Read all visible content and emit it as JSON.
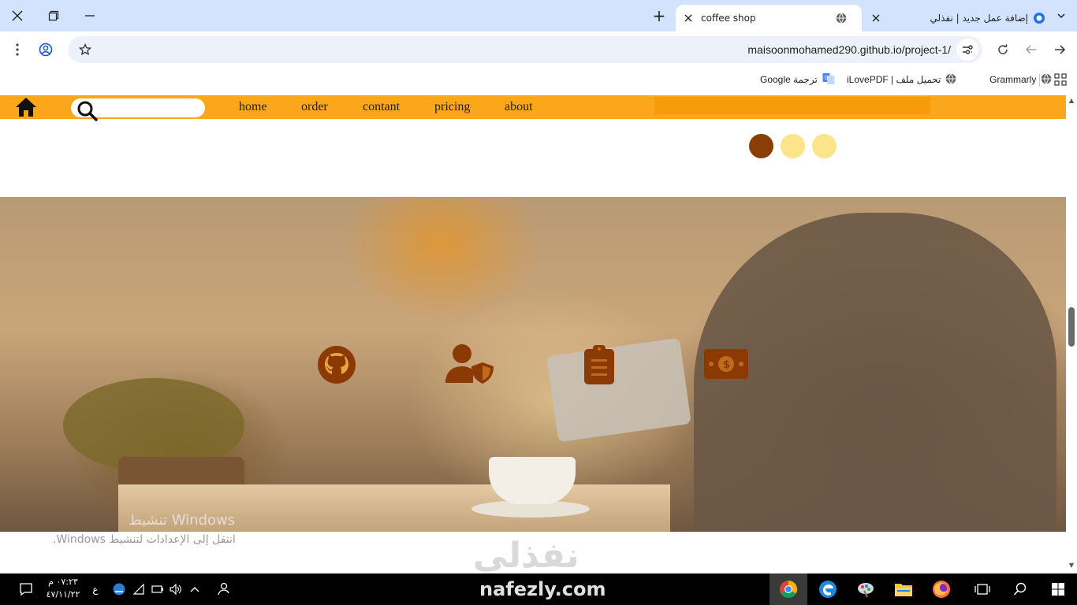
{
  "browser": {
    "tabs": [
      {
        "title": "coffee shop",
        "active": true
      },
      {
        "title": "إضافة عمل جديد | نفذلي",
        "active": false
      }
    ],
    "new_tab_symbol": "+",
    "url": "maisoonmohamed290.github.io/project-1/",
    "bookmarks": [
      {
        "label": "Grammarly",
        "icon": "globe-icon"
      },
      {
        "label": "iLovePDF | تحميل ملف",
        "icon": "globe-icon"
      },
      {
        "label": "ترجمة Google",
        "icon": "translate-icon"
      }
    ]
  },
  "site": {
    "nav": {
      "links": [
        "home",
        "order",
        "contant",
        "pricing",
        "about"
      ],
      "search_placeholder": ""
    },
    "colors": {
      "nav_bg": "#fca61b",
      "dot_active": "#8b3d06",
      "dot_inactive": "#fde48a",
      "icon_brown": "#8b3a06"
    },
    "slider": {
      "dots": 3,
      "active_index": 0
    },
    "features": [
      {
        "icon": "github-icon"
      },
      {
        "icon": "user-shield-icon"
      },
      {
        "icon": "clipboard-list-icon"
      },
      {
        "icon": "money-bill-icon"
      }
    ]
  },
  "overlay": {
    "activation_title": "تنشيط Windows",
    "activation_sub": "انتقل إلى الإعدادات لتنشيط Windows.",
    "watermark_logo": "نفذلي",
    "watermark_url": "nafezly.com"
  },
  "taskbar": {
    "time": "٠٧:٢٣ م",
    "date": "٤٧/١١/٢٢",
    "lang": "ع"
  }
}
